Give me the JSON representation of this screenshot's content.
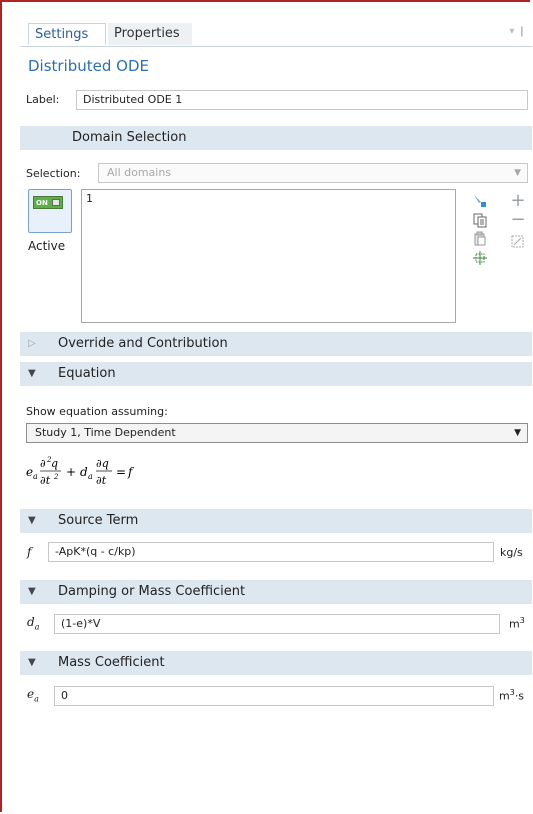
{
  "tabs": {
    "settings": "Settings",
    "properties": "Properties",
    "tools": "▾ ❙"
  },
  "node_title": "Distributed ODE",
  "label_field": {
    "label": "Label:",
    "value": "Distributed ODE 1"
  },
  "domain_selection": {
    "header": "Domain Selection",
    "selection_label": "Selection:",
    "selection_value": "All domains",
    "active_label": "Active",
    "toggle_text": "ON",
    "list_items": [
      "1"
    ]
  },
  "override_section": {
    "header": "Override and Contribution"
  },
  "equation_section": {
    "header": "Equation",
    "show_label": "Show equation assuming:",
    "study_value": "Study 1, Time Dependent",
    "equation_text": "e_a ∂²q/∂t² + d_a ∂q/∂t = f"
  },
  "source_term": {
    "header": "Source Term",
    "symbol": "f",
    "value": "-ApK*(q - c/kp)",
    "unit": "kg/s"
  },
  "damping": {
    "header": "Damping or Mass Coefficient",
    "symbol": "d",
    "symbol_sub": "a",
    "value": "(1-e)*V",
    "unit": "m",
    "unit_sup": "3"
  },
  "mass": {
    "header": "Mass Coefficient",
    "symbol": "e",
    "symbol_sub": "a",
    "value": "0",
    "unit": "m",
    "unit_sup": "3",
    "unit_suffix": "·s"
  },
  "icons": {
    "paste_selection": "paste-selection-icon",
    "copy_selection": "copy-selection-icon",
    "clear_selection": "clear-selection-icon",
    "zoom_to_selection": "zoom-to-selection-icon",
    "add": "add-icon",
    "remove": "remove-icon",
    "create_selection": "create-selection-icon"
  }
}
